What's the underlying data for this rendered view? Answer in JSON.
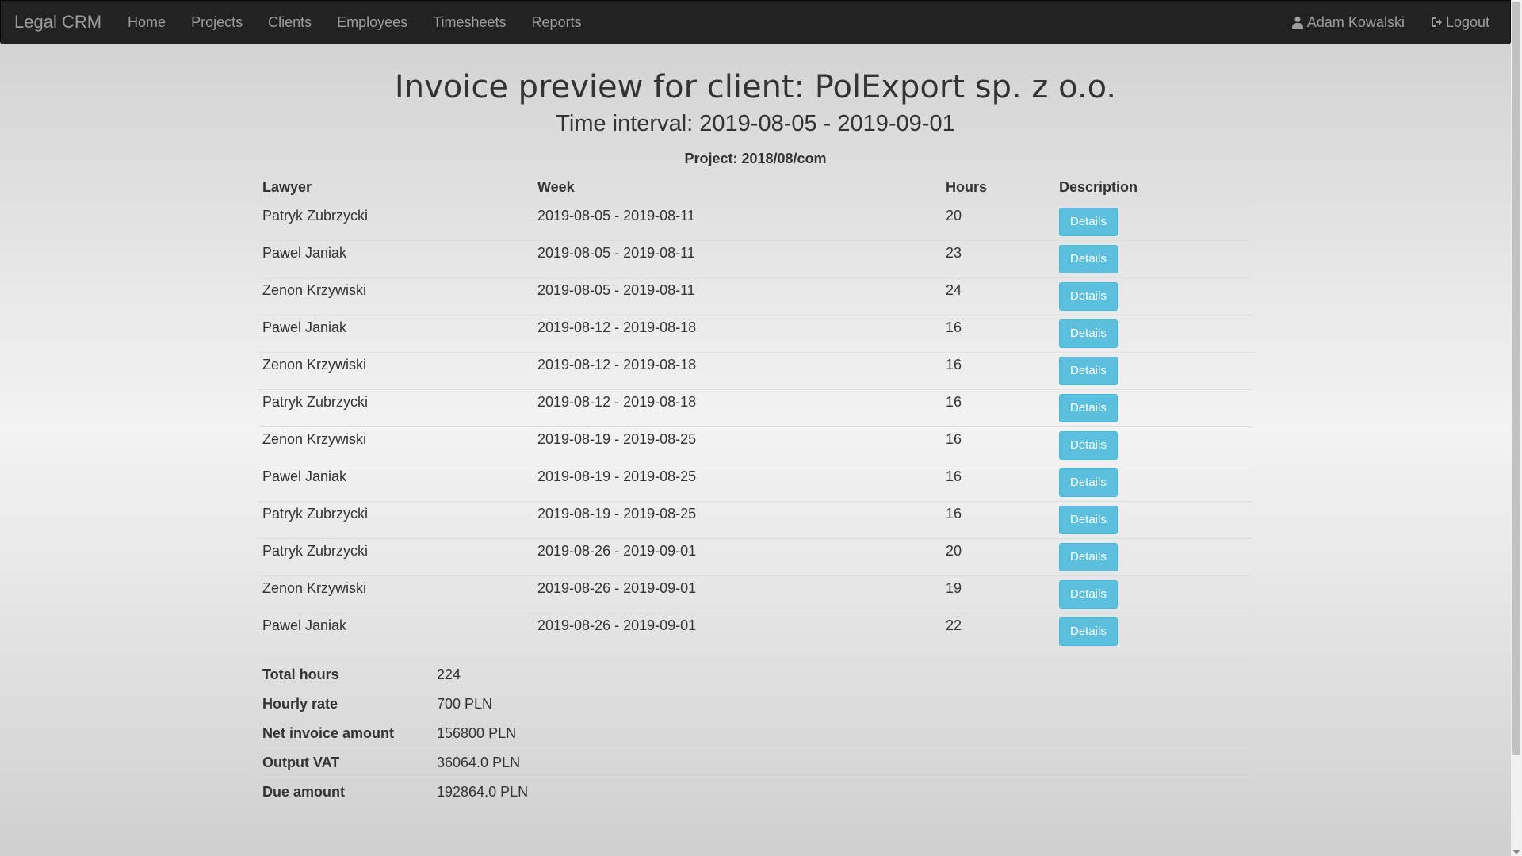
{
  "nav": {
    "brand": "Legal CRM",
    "links": [
      "Home",
      "Projects",
      "Clients",
      "Employees",
      "Timesheets",
      "Reports"
    ],
    "user": "Adam Kowalski",
    "logout": "Logout",
    "user_icon": "user-icon",
    "logout_icon": "logout-icon"
  },
  "page": {
    "title": "Invoice preview for client: PolExport sp. z o.o.",
    "interval": "Time interval: 2019-08-05 - 2019-09-01",
    "project": "Project: 2018/08/com"
  },
  "table": {
    "headers": [
      "Lawyer",
      "Week",
      "Hours",
      "Description"
    ],
    "button_label": "Details",
    "rows": [
      {
        "lawyer": "Patryk Zubrzycki",
        "week": "2019-08-05 - 2019-08-11",
        "hours": "20"
      },
      {
        "lawyer": "Pawel Janiak",
        "week": "2019-08-05 - 2019-08-11",
        "hours": "23"
      },
      {
        "lawyer": "Zenon Krzywiski",
        "week": "2019-08-05 - 2019-08-11",
        "hours": "24"
      },
      {
        "lawyer": "Pawel Janiak",
        "week": "2019-08-12 - 2019-08-18",
        "hours": "16"
      },
      {
        "lawyer": "Zenon Krzywiski",
        "week": "2019-08-12 - 2019-08-18",
        "hours": "16"
      },
      {
        "lawyer": "Patryk Zubrzycki",
        "week": "2019-08-12 - 2019-08-18",
        "hours": "16"
      },
      {
        "lawyer": "Zenon Krzywiski",
        "week": "2019-08-19 - 2019-08-25",
        "hours": "16"
      },
      {
        "lawyer": "Pawel Janiak",
        "week": "2019-08-19 - 2019-08-25",
        "hours": "16"
      },
      {
        "lawyer": "Patryk Zubrzycki",
        "week": "2019-08-19 - 2019-08-25",
        "hours": "16"
      },
      {
        "lawyer": "Patryk Zubrzycki",
        "week": "2019-08-26 - 2019-09-01",
        "hours": "20"
      },
      {
        "lawyer": "Zenon Krzywiski",
        "week": "2019-08-26 - 2019-09-01",
        "hours": "19"
      },
      {
        "lawyer": "Pawel Janiak",
        "week": "2019-08-26 - 2019-09-01",
        "hours": "22"
      }
    ]
  },
  "summary": [
    {
      "label": "Total hours",
      "value": "224"
    },
    {
      "label": "Hourly rate",
      "value": "700 PLN"
    },
    {
      "label": "Net invoice amount",
      "value": "156800 PLN"
    },
    {
      "label": "Output VAT",
      "value": "36064.0 PLN"
    },
    {
      "label": "Due amount",
      "value": "192864.0 PLN"
    }
  ],
  "colors": {
    "navbar": "#222222",
    "nav_text": "#9d9d9d",
    "button": "#5bc0de"
  }
}
